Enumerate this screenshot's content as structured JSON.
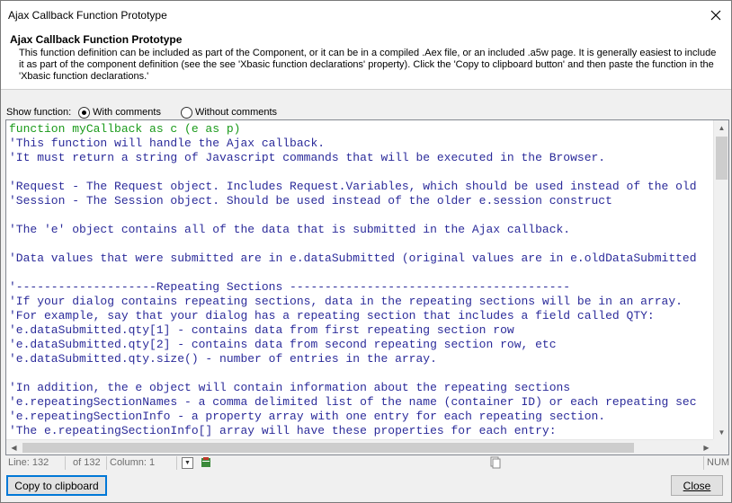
{
  "window": {
    "title": "Ajax Callback Function Prototype"
  },
  "header": {
    "title": "Ajax Callback Function Prototype",
    "description": "This function definition can be included as part of the Component, or it can be in a compiled .Aex file, or an included .a5w page. It is generally easiest to include it as part of the component definition (see the see 'Xbasic function declarations' property). Click the 'Copy to clipboard button' and then paste the function in the 'Xbasic function declarations.'"
  },
  "show_function": {
    "label": "Show function:",
    "options": [
      {
        "label": "With comments",
        "selected": true
      },
      {
        "label": "Without comments",
        "selected": false
      }
    ]
  },
  "code": {
    "lines": [
      "function myCallback as c (e as p)",
      "'This function will handle the Ajax callback.",
      "'It must return a string of Javascript commands that will be executed in the Browser.",
      "",
      "'Request - The Request object. Includes Request.Variables, which should be used instead of the old",
      "'Session - The Session object. Should be used instead of the older e.session construct",
      "",
      "'The 'e' object contains all of the data that is submitted in the Ajax callback.",
      "",
      "'Data values that were submitted are in e.dataSubmitted (original values are in e.oldDataSubmitted",
      "",
      "'--------------------Repeating Sections ----------------------------------------",
      "'If your dialog contains repeating sections, data in the repeating sections will be in an array.",
      "'For example, say that your dialog has a repeating section that includes a field called QTY:",
      "'e.dataSubmitted.qty[1] - contains data from first repeating section row",
      "'e.dataSubmitted.qty[2] - contains data from second repeating section row, etc",
      "'e.dataSubmitted.qty.size() - number of entries in the array.",
      "",
      "'In addition, the e object will contain information about the repeating sections",
      "'e.repeatingSectionNames - a comma delimited list of the name (container ID) or each repeating sec",
      "'e.repeatingSectionInfo - a property array with one entry for each repeating section.",
      "'The e.repeatingSectionInfo[] array will have these properties for each entry:"
    ]
  },
  "status": {
    "line": "Line: 132",
    "of": "of 132",
    "column": "Column: 1",
    "num": "NUM"
  },
  "buttons": {
    "copy": "Copy to clipboard",
    "close": "Close"
  },
  "colors": {
    "function_line": "#1a9a1a",
    "comment": "#2b2b9a",
    "focus_border": "#0078d7"
  }
}
